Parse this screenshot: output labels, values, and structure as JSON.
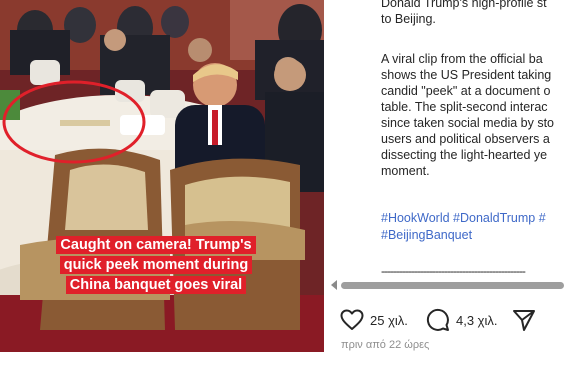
{
  "media": {
    "overlay_caption": [
      "Caught on camera! Trump's",
      "quick peek moment during",
      "China banquet goes viral"
    ]
  },
  "post": {
    "paragraphs": [
      "Donald Trump's high-profile st\nto Beijing.",
      "A viral clip from the official ba\nshows the US President taking\ncandid \"peek\" at a document o\ntable. The split-second interac\nsince taken social media by sto\nusers and political observers a\ndissecting the light-hearted ye\nmoment."
    ],
    "hashtags": "#HookWorld #DonaldTrump #\n#BeijingBanquet",
    "divider": "------------------------------------------------"
  },
  "actions": {
    "likes": "25 χιλ.",
    "comments": "4,3 χιλ.",
    "timestamp": "πριν από 22 ώρες"
  },
  "colors": {
    "caption_bg": "#e0202a",
    "hashtag": "#3f69c8",
    "annotation_circle": "#e0202a"
  },
  "icons": [
    "heart-icon",
    "comment-icon",
    "share-icon",
    "scroll-left-arrow-icon"
  ]
}
